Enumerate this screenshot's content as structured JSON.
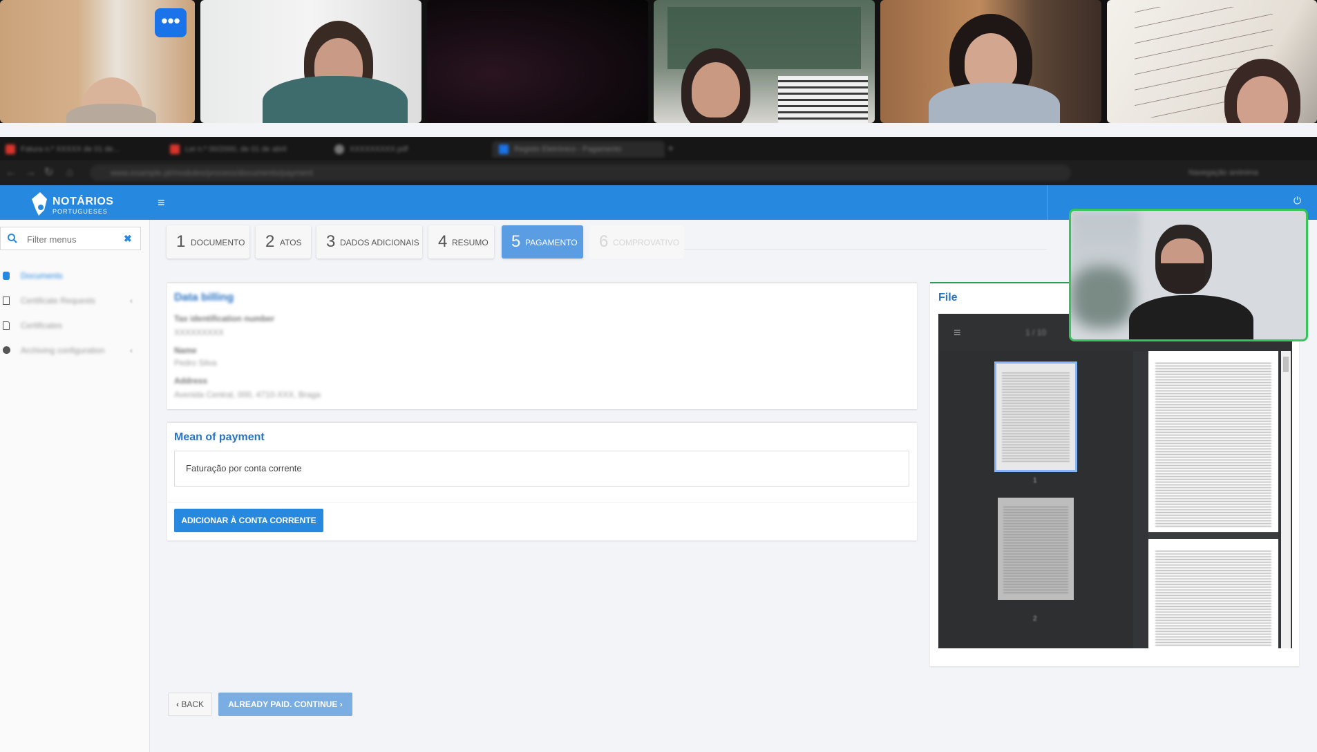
{
  "video_call": {
    "more_button_label": "•••",
    "participant_count": 7
  },
  "browser": {
    "tabs": [
      {
        "title": "Fatura n.º XXXXX de 01 de...",
        "favicon_color": "#d9352b"
      },
      {
        "title": "Lei n.º 00/2000, de 01 de abril",
        "favicon_color": "#d9352b"
      },
      {
        "title": "XXXXXXXXX.pdf",
        "favicon_color": "#777777"
      },
      {
        "title": "Registo Eletrónico - Pagamento",
        "favicon_color": "#1a73e8"
      }
    ],
    "address": "www.example.pt/modules/process/documents/payment",
    "profile_label": "Navegação anónima"
  },
  "app": {
    "logo_title": "NOTÁRIOS",
    "logo_subtitle": "PORTUGUESES",
    "brand_color": "#2788e0"
  },
  "sidebar": {
    "filter_placeholder": "Filter menus",
    "items": [
      {
        "label": "Documents",
        "icon": "database-icon",
        "active": true
      },
      {
        "label": "Certificate Requests",
        "icon": "checkbox-icon",
        "has_submenu": true
      },
      {
        "label": "Certificates",
        "icon": "file-icon"
      },
      {
        "label": "Archiving configuration",
        "icon": "gear-icon",
        "has_submenu": true
      }
    ]
  },
  "steps": [
    {
      "number": "1",
      "label": "DOCUMENTO",
      "state": "done"
    },
    {
      "number": "2",
      "label": "ATOS",
      "state": "done"
    },
    {
      "number": "3",
      "label": "DADOS ADICIONAIS",
      "state": "done"
    },
    {
      "number": "4",
      "label": "RESUMO",
      "state": "done"
    },
    {
      "number": "5",
      "label": "PAGAMENTO",
      "state": "active"
    },
    {
      "number": "6",
      "label": "COMPROVATIVO",
      "state": "disabled"
    }
  ],
  "billing": {
    "title": "Data billing",
    "fields": [
      {
        "label": "Tax identification number",
        "value": "XXXXXXXXX"
      },
      {
        "label": "Name",
        "value": "Pedro Silva"
      },
      {
        "label": "Address",
        "value": "Avenida Central, 000, 4710-XXX, Braga"
      }
    ]
  },
  "payment": {
    "title": "Mean of payment",
    "method": "Faturação por conta corrente",
    "add_button": "ADICIONAR À CONTA CORRENTE"
  },
  "footer_actions": {
    "back_label": "BACK",
    "continue_label": "ALREADY PAID. CONTINUE"
  },
  "file_panel": {
    "title": "File",
    "page_indicator": "1 / 10",
    "thumbnail_numbers": [
      "1",
      "2"
    ]
  }
}
